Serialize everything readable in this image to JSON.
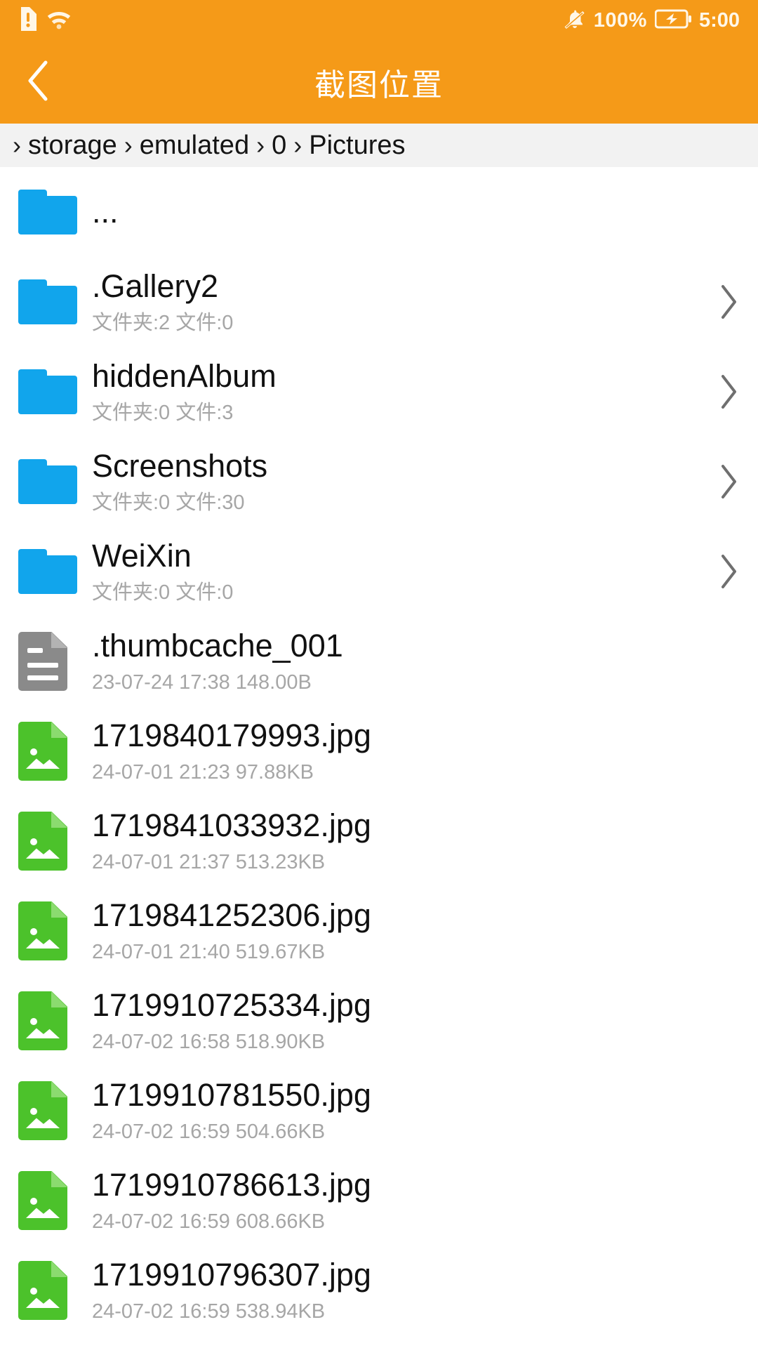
{
  "status_bar": {
    "sim_icon": "sim-card-alert-icon",
    "wifi_icon": "wifi-icon",
    "mute_icon": "bell-muted-icon",
    "battery_percent": "100%",
    "battery_icon": "battery-charging-icon",
    "time": "5:00"
  },
  "app_bar": {
    "back_icon": "back-chevron-icon",
    "title": "截图位置"
  },
  "breadcrumb": {
    "separator": "›",
    "crumbs": [
      "storage",
      "emulated",
      "0",
      "Pictures"
    ]
  },
  "colors": {
    "accent": "#F59A18",
    "folder": "#11A5EC",
    "image_file": "#4CC22B",
    "generic_file": "#8A8A8A",
    "breadcrumb_bg": "#F2F2F2",
    "meta_text": "#A6A6A6"
  },
  "files": [
    {
      "name": "...",
      "meta": "",
      "kind": "folder",
      "chevron": false
    },
    {
      "name": ".Gallery2",
      "meta": "文件夹:2 文件:0",
      "kind": "folder",
      "chevron": true
    },
    {
      "name": "hiddenAlbum",
      "meta": "文件夹:0 文件:3",
      "kind": "folder",
      "chevron": true
    },
    {
      "name": "Screenshots",
      "meta": "文件夹:0 文件:30",
      "kind": "folder",
      "chevron": true
    },
    {
      "name": "WeiXin",
      "meta": "文件夹:0 文件:0",
      "kind": "folder",
      "chevron": true
    },
    {
      "name": ".thumbcache_001",
      "meta": "23-07-24 17:38  148.00B",
      "kind": "file",
      "chevron": false
    },
    {
      "name": "1719840179993.jpg",
      "meta": "24-07-01 21:23  97.88KB",
      "kind": "image",
      "chevron": false
    },
    {
      "name": "1719841033932.jpg",
      "meta": "24-07-01 21:37  513.23KB",
      "kind": "image",
      "chevron": false
    },
    {
      "name": "1719841252306.jpg",
      "meta": "24-07-01 21:40  519.67KB",
      "kind": "image",
      "chevron": false
    },
    {
      "name": "1719910725334.jpg",
      "meta": "24-07-02 16:58  518.90KB",
      "kind": "image",
      "chevron": false
    },
    {
      "name": "1719910781550.jpg",
      "meta": "24-07-02 16:59  504.66KB",
      "kind": "image",
      "chevron": false
    },
    {
      "name": "1719910786613.jpg",
      "meta": "24-07-02 16:59  608.66KB",
      "kind": "image",
      "chevron": false
    },
    {
      "name": "1719910796307.jpg",
      "meta": "24-07-02 16:59  538.94KB",
      "kind": "image",
      "chevron": false
    }
  ]
}
